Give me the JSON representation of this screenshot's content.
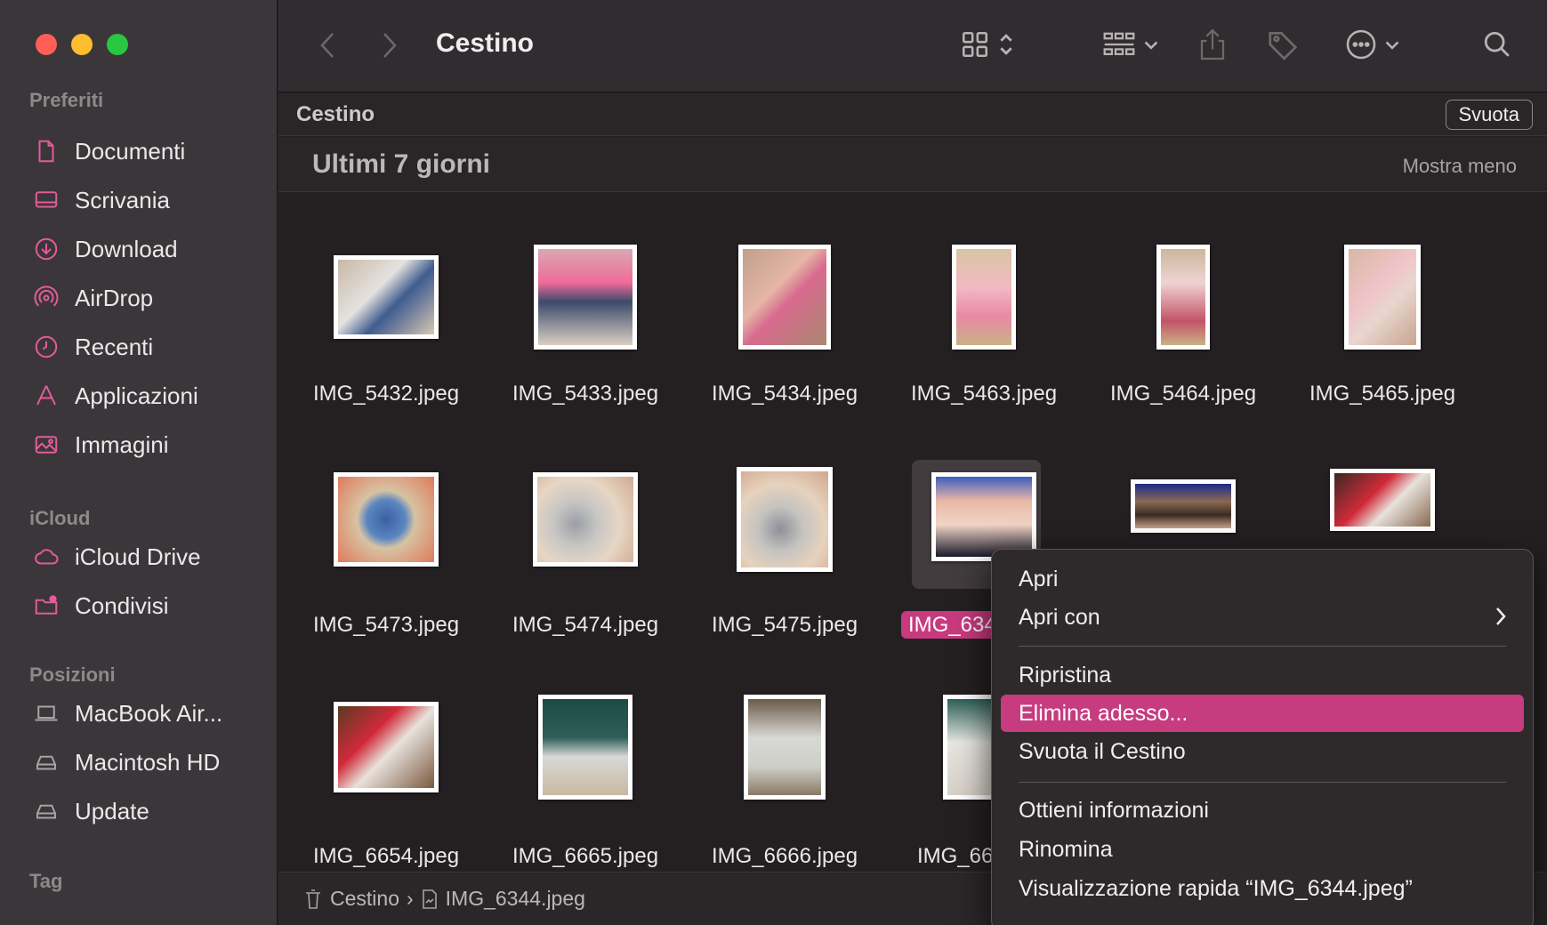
{
  "window": {
    "title": "Cestino"
  },
  "sidebar": {
    "sections": [
      {
        "label": "Preferiti"
      },
      {
        "label": "iCloud"
      },
      {
        "label": "Posizioni"
      },
      {
        "label": "Tag"
      }
    ],
    "favorites": [
      {
        "label": "Documenti",
        "icon": "document-icon"
      },
      {
        "label": "Scrivania",
        "icon": "desktop-icon"
      },
      {
        "label": "Download",
        "icon": "download-icon"
      },
      {
        "label": "AirDrop",
        "icon": "airdrop-icon"
      },
      {
        "label": "Recenti",
        "icon": "clock-icon"
      },
      {
        "label": "Applicazioni",
        "icon": "applications-icon"
      },
      {
        "label": "Immagini",
        "icon": "photo-icon"
      }
    ],
    "icloud": [
      {
        "label": "iCloud Drive",
        "icon": "cloud-icon"
      },
      {
        "label": "Condivisi",
        "icon": "shared-folder-icon"
      }
    ],
    "locations": [
      {
        "label": "MacBook Air...",
        "icon": "laptop-icon"
      },
      {
        "label": "Macintosh HD",
        "icon": "disk-icon"
      },
      {
        "label": "Update",
        "icon": "disk-icon"
      }
    ]
  },
  "pathbar": {
    "label": "Cestino",
    "empty_button": "Svuota"
  },
  "group": {
    "title": "Ultimi 7 giorni",
    "toggle": "Mostra meno"
  },
  "files": [
    {
      "name": "IMG_5432.jpeg"
    },
    {
      "name": "IMG_5433.jpeg"
    },
    {
      "name": "IMG_5434.jpeg"
    },
    {
      "name": "IMG_5463.jpeg"
    },
    {
      "name": "IMG_5464.jpeg"
    },
    {
      "name": "IMG_5465.jpeg"
    },
    {
      "name": "IMG_5473.jpeg"
    },
    {
      "name": "IMG_5474.jpeg"
    },
    {
      "name": "IMG_5475.jpeg"
    },
    {
      "name": "IMG_634",
      "selected": true
    },
    {
      "name": ""
    },
    {
      "name": ""
    },
    {
      "name": "IMG_6654.jpeg"
    },
    {
      "name": "IMG_6665.jpeg"
    },
    {
      "name": "IMG_6666.jpeg"
    },
    {
      "name": "IMG_666"
    }
  ],
  "statusbar": {
    "crumb_root": "Cestino",
    "crumb_file": "IMG_6344.jpeg"
  },
  "context_menu": {
    "items": [
      {
        "label": "Apri"
      },
      {
        "label": "Apri con",
        "submenu": true
      },
      {
        "label": "Ripristina"
      },
      {
        "label": "Elimina adesso...",
        "highlighted": true
      },
      {
        "label": "Svuota il Cestino"
      },
      {
        "label": "Ottieni informazioni"
      },
      {
        "label": "Rinomina"
      },
      {
        "label": "Visualizzazione rapida “IMG_6344.jpeg”"
      }
    ]
  },
  "colors": {
    "accent": "#c63c7f",
    "sidebar": "#3b3639",
    "toolbar": "#312c2f"
  }
}
